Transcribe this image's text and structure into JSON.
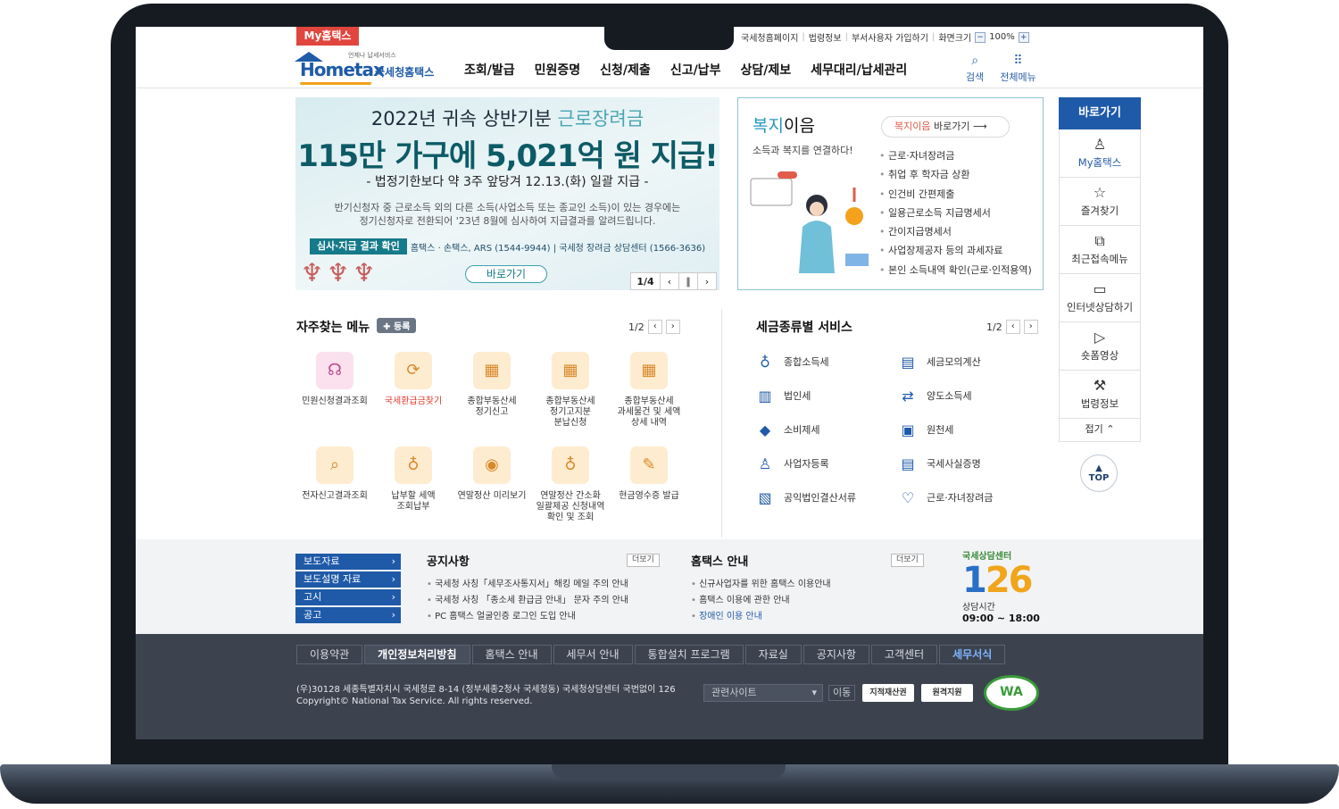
{
  "util": {
    "my_hometax": "My홈택스",
    "links": [
      "국세청홈페이지",
      "법령정보",
      "부서사용자 가입하기",
      "화면크기"
    ],
    "zoom": "100%"
  },
  "logo": {
    "tagline": "언제나 납세서비스",
    "brand": "Hometax",
    "org": "국세청홈택스"
  },
  "gnb": [
    "조회/발급",
    "민원증명",
    "신청/제출",
    "신고/납부",
    "상담/제보",
    "세무대리/납세관리"
  ],
  "header_icons": {
    "search": "검색",
    "all_menu": "전체메뉴"
  },
  "banner": {
    "line1_a": "2022년 귀속 상반기분 ",
    "line1_b": "근로장려금",
    "headline": "115만 가구에 5,021억 원 지급!",
    "subline": "- 법정기한보다 약 3주 앞당겨 12.13.(화) 일괄 지급 -",
    "desc1": "반기신청자 중 근로소득 외의 다른 소득(사업소득 또는 종교인 소득)이 있는 경우에는",
    "desc2": "정기신청자로 전환되어 '23년 8월에 심사하여 지급결과를 알려드립니다.",
    "tag": "심사·지급 결과 확인",
    "contact": "홈택스 · 손택스, ARS (1544-9944) | 국세청 장려금 상담센터 (1566-3636)",
    "go": "바로가기",
    "page": "1/4"
  },
  "welfare": {
    "title_a": "복지",
    "title_b": "이음",
    "sub": "소득과 복지를 연결하다!",
    "go_a": "복지이음",
    "go_b": " 바로가기",
    "items": [
      "근로·자녀장려금",
      "취업 후 학자금 상환",
      "인건비 간편제출",
      "일용근로소득 지급명세서",
      "간이지급명세서",
      "사업장제공자 등의 과세자료",
      "본인 소득내역 확인(근로·인적용역)"
    ]
  },
  "quick": {
    "head": "바로가기",
    "items": [
      "My홈택스",
      "즐겨찾기",
      "최근접속메뉴",
      "인터넷상담하기",
      "숏폼영상",
      "법령정보"
    ],
    "fold": "접기",
    "top": "TOP"
  },
  "freq": {
    "title": "자주찾는 메뉴",
    "reg": "✚ 등록",
    "page": "1/2",
    "items": [
      {
        "l1": "민원신청결과조회",
        "l2": "",
        "l3": ""
      },
      {
        "l1": "국세환급금찾기",
        "l2": "",
        "l3": ""
      },
      {
        "l1": "종합부동산세",
        "l2": "정기신고",
        "l3": ""
      },
      {
        "l1": "종합부동산세",
        "l2": "정기고지분",
        "l3": "분납신청"
      },
      {
        "l1": "종합부동산세",
        "l2": "과세물건 및 세액",
        "l3": "상세 내역"
      },
      {
        "l1": "전자신고결과조회",
        "l2": "",
        "l3": ""
      },
      {
        "l1": "납부할 세액",
        "l2": "조회납부",
        "l3": ""
      },
      {
        "l1": "연말정산 미리보기",
        "l2": "",
        "l3": ""
      },
      {
        "l1": "연말정산 간소화",
        "l2": "일괄제공 신청내역",
        "l3": "확인 및 조회"
      },
      {
        "l1": "현금영수증 발급",
        "l2": "",
        "l3": ""
      }
    ]
  },
  "tax": {
    "title": "세금종류별 서비스",
    "page": "1/2",
    "items": [
      "종합소득세",
      "세금모의계산",
      "법인세",
      "양도소득세",
      "소비제세",
      "원천세",
      "사업자등록",
      "국세사실증명",
      "공익법인결산서류",
      "근로·자녀장려금"
    ]
  },
  "press": [
    "보도자료",
    "보도설명 자료",
    "고시",
    "공고"
  ],
  "notice": {
    "title": "공지사항",
    "more": "더보기",
    "items": [
      "국세청 사칭「세무조사통지서」해킹 메일 주의 안내",
      "국세청 사칭 「종소세 환급금 안내」 문자 주의 안내",
      "PC 홈택스 얼굴인증 로그인 도입 안내"
    ]
  },
  "guide": {
    "title": "홈택스 안내",
    "more": "더보기",
    "items": [
      "신규사업자를 위한 홈택스 이용안내",
      "홈택스 이용에 관한 안내",
      "장애인 이용 안내"
    ]
  },
  "callcenter": {
    "title": "국세상담센터",
    "num_a": "1",
    "num_b": "26",
    "label": "상담시간",
    "hours": "09:00 ~ 18:00"
  },
  "footer": {
    "menu": [
      "이용약관",
      "개인정보처리방침",
      "홈택스 안내",
      "세무서 안내",
      "통합설치 프로그램",
      "자료실",
      "공지사항",
      "고객센터",
      "세무서식"
    ],
    "addr1": "(우)30128 세종특별자치시 국세청로 8-14 (정부세종2청사 국세청동) 국세청상담센터 국번없이 126",
    "addr2": "Copyright© National Tax Service. All rights reserved.",
    "related": "관련사이트",
    "move": "이동",
    "badge1": "지적재산권",
    "badge2": "원격지원",
    "wa": "WA"
  },
  "colors": {
    "primary": "#1f5aa8",
    "accent_red": "#e0463e",
    "teal": "#157a8a",
    "footer_bg": "#3c434f"
  }
}
